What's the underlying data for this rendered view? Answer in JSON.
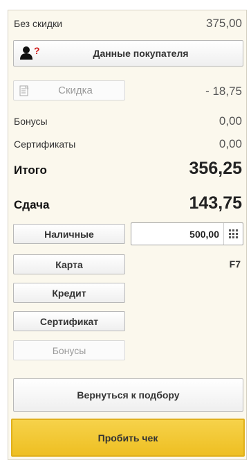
{
  "summary": {
    "no_discount_label": "Без скидки",
    "no_discount_value": "375,00",
    "bonuses_label": "Бонусы",
    "bonuses_value": "0,00",
    "certificates_label": "Сертификаты",
    "certificates_value": "0,00",
    "total_label": "Итого",
    "total_value": "356,25",
    "change_label": "Сдача",
    "change_value": "143,75"
  },
  "buyer": {
    "button_label": "Данные покупателя",
    "icon": "user-question-icon"
  },
  "discount": {
    "button_label": "Скидка",
    "value": "- 18,75",
    "icon": "document-percent-icon"
  },
  "payments": {
    "cash_label": "Наличные",
    "cash_amount": "500,00",
    "calculator_icon": "calculator-icon",
    "card_label": "Карта",
    "card_hotkey": "F7",
    "credit_label": "Кредит",
    "certificate_label": "Сертификат",
    "bonuses_label": "Бонусы"
  },
  "actions": {
    "back_label": "Вернуться к подбору",
    "check_label": "Пробить чек"
  },
  "colors": {
    "panel_background": "#fbf8ed",
    "accent_yellow": "#f0c32a",
    "accent_border": "#e0b01a",
    "user_icon_question": "#d11a1a"
  }
}
